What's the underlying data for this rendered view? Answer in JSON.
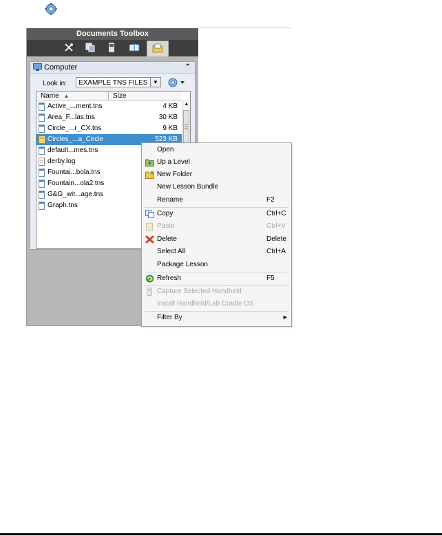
{
  "window": {
    "title": "Documents Toolbox"
  },
  "tabs": [
    {
      "icon": "tools-icon"
    },
    {
      "icon": "page-sorter-icon"
    },
    {
      "icon": "handheld-icon"
    },
    {
      "icon": "book-icon"
    },
    {
      "icon": "folder-explorer-icon",
      "active": true
    }
  ],
  "computer": {
    "title": "Computer",
    "lookin_label": "Look in:",
    "lookin_value": "EXAMPLE TNS FILES",
    "columns": {
      "name": "Name",
      "size": "Size"
    },
    "files": [
      {
        "name": "Active_...ment.tns",
        "size": "4 KB",
        "icon": "tns-file-icon"
      },
      {
        "name": "Area_F...las.tns",
        "size": "30 KB",
        "icon": "tns-file-icon"
      },
      {
        "name": "Circle_...r_CX.tns",
        "size": "9 KB",
        "icon": "tns-file-icon"
      },
      {
        "name": "Circles_...a_Circle",
        "size": "523 KB",
        "icon": "lesson-bundle-icon",
        "selected": true
      },
      {
        "name": "default...mes.tns",
        "size": "",
        "icon": "tns-file-icon"
      },
      {
        "name": "derby.log",
        "size": "",
        "icon": "text-file-icon"
      },
      {
        "name": "Fountai...bola.tns",
        "size": "",
        "icon": "tns-file-icon"
      },
      {
        "name": "Fountain...ola2.tns",
        "size": "",
        "icon": "tns-file-icon"
      },
      {
        "name": "G&G_wit...age.tns",
        "size": "",
        "icon": "tns-file-icon"
      },
      {
        "name": "Graph.tns",
        "size": "",
        "icon": "tns-file-icon"
      }
    ]
  },
  "context_menu": {
    "items": [
      {
        "label": "Open",
        "shortcut": "",
        "icon": "",
        "enabled": true
      },
      {
        "label": "Up a Level",
        "shortcut": "",
        "icon": "up-folder-icon",
        "enabled": true
      },
      {
        "label": "New Folder",
        "shortcut": "",
        "icon": "new-folder-icon",
        "enabled": true
      },
      {
        "label": "New Lesson Bundle",
        "shortcut": "",
        "icon": "",
        "enabled": true
      },
      {
        "label": "Rename",
        "shortcut": "F2",
        "icon": "",
        "enabled": true
      },
      {
        "label": "Copy",
        "shortcut": "Ctrl+C",
        "icon": "copy-icon",
        "enabled": true
      },
      {
        "label": "Paste",
        "shortcut": "Ctrl+V",
        "icon": "paste-icon",
        "enabled": false
      },
      {
        "label": "Delete",
        "shortcut": "Delete",
        "icon": "delete-icon",
        "enabled": true
      },
      {
        "label": "Select All",
        "shortcut": "Ctrl+A",
        "icon": "",
        "enabled": true
      },
      {
        "label": "Package Lesson",
        "shortcut": "",
        "icon": "",
        "enabled": true
      },
      {
        "label": "Refresh",
        "shortcut": "F5",
        "icon": "refresh-icon",
        "enabled": true
      },
      {
        "label": "Capture Selected Handheld",
        "shortcut": "",
        "icon": "capture-icon",
        "enabled": false
      },
      {
        "label": "Install Handheld/Lab Cradle OS",
        "shortcut": "",
        "icon": "",
        "enabled": false
      },
      {
        "label": "Filter By",
        "shortcut": "",
        "icon": "",
        "enabled": true,
        "submenu": true
      }
    ]
  },
  "colors": {
    "selection": "#3d8fd0",
    "title_bar": "#5a5a5a",
    "tab_bar": "#3e3e3e"
  }
}
